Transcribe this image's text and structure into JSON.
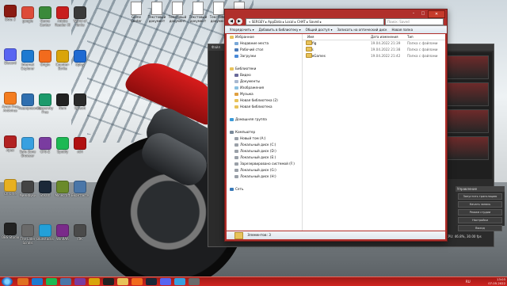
{
  "desktop_icons": [
    {
      "label": "Dota 2",
      "color": "#8a1a12"
    },
    {
      "label": "Discord",
      "color": "#5865f2"
    },
    {
      "label": "Avast Free Antivirus",
      "color": "#f47d20"
    },
    {
      "label": "Apex",
      "color": "#b22222"
    },
    {
      "label": "Chrome",
      "color": "#e8b020"
    },
    {
      "label": "OBS Studio",
      "color": "#222222"
    },
    {
      "label": "google",
      "color": "#dd4b39"
    },
    {
      "label": "Internet Explorer",
      "color": "#1e7ad1"
    },
    {
      "label": "Кеширование",
      "color": "#2f6fb0"
    },
    {
      "label": "Safe Zone Browser",
      "color": "#38a0e0"
    },
    {
      "label": "Минибуки",
      "color": "#444444"
    },
    {
      "label": "The Elder Scrolls",
      "color": "#6a6a6a"
    },
    {
      "label": "Game Center",
      "color": "#3a8a3a"
    },
    {
      "label": "Origin",
      "color": "#f26b1d"
    },
    {
      "label": "Kaspersky Free",
      "color": "#1b9a6b"
    },
    {
      "label": "CPU-Z",
      "color": "#7a3ca0"
    },
    {
      "label": "Steam",
      "color": "#1b2838"
    },
    {
      "label": "Bluestacks",
      "color": "#23a0d8"
    },
    {
      "label": "Adobe Reader XI",
      "color": "#c81e1e"
    },
    {
      "label": "Counter-Strike",
      "color": "#d9a40a"
    },
    {
      "label": "Nero",
      "color": "#222222"
    },
    {
      "label": "Spotify",
      "color": "#1db954"
    },
    {
      "label": "Minecraft",
      "color": "#6a8a2a"
    },
    {
      "label": "WinRAR",
      "color": "#7a2a8a"
    },
    {
      "label": "World of Tanks",
      "color": "#3a3a3a"
    },
    {
      "label": "Uplay",
      "color": "#1e6ad2"
    },
    {
      "label": "Ubisoft",
      "color": "#2a2a2a"
    },
    {
      "label": "x64",
      "color": "#b01010"
    },
    {
      "label": "Вконтакте",
      "color": "#4a76a8"
    },
    {
      "label": "ПК",
      "color": "#4a4a4a"
    }
  ],
  "top_files": [
    {
      "label": "Game Center"
    },
    {
      "label": "Текстовый документ"
    },
    {
      "label": "Текстовый документ"
    },
    {
      "label": "Текстовый документ"
    },
    {
      "label": "Текстовый документ"
    },
    {
      "label": "Текстовый документ"
    }
  ],
  "explorer": {
    "breadcrumb": "« SERGEY ▸ AppData ▸ Local ▸ CHAT ▸ Saved ▸",
    "search_placeholder": "Поиск: Saved",
    "toolbar": [
      "Упорядочить ▾",
      "Добавить в библиотеку ▾",
      "Общий доступ ▾",
      "Записать на оптический диск",
      "Новая папка"
    ],
    "nav": [
      {
        "label": "Избранное",
        "color": "#e8c25a",
        "indent": 0
      },
      {
        "label": "Недавние места",
        "color": "#7aa8d8",
        "indent": 1
      },
      {
        "label": "Рабочий стол",
        "color": "#4a7ab8",
        "indent": 1
      },
      {
        "label": "Загрузки",
        "color": "#4a8ad8",
        "indent": 1
      },
      {
        "label": "",
        "color": "transparent",
        "indent": 0
      },
      {
        "label": "Библиотеки",
        "color": "#e8c25a",
        "indent": 0
      },
      {
        "label": "Видео",
        "color": "#6a6a9a",
        "indent": 1
      },
      {
        "label": "Документы",
        "color": "#a8b8d0",
        "indent": 1
      },
      {
        "label": "Изображения",
        "color": "#8ac0e0",
        "indent": 1
      },
      {
        "label": "Музыка",
        "color": "#e0a040",
        "indent": 1
      },
      {
        "label": "Новая библиотека (2)",
        "color": "#e8c25a",
        "indent": 1
      },
      {
        "label": "Новая библиотека",
        "color": "#e8c25a",
        "indent": 1
      },
      {
        "label": "",
        "color": "transparent",
        "indent": 0
      },
      {
        "label": "Домашняя группа",
        "color": "#3a9ad8",
        "indent": 0
      },
      {
        "label": "",
        "color": "transparent",
        "indent": 0
      },
      {
        "label": "Компьютер",
        "color": "#7a8a9a",
        "indent": 0
      },
      {
        "label": "Новый том (A:)",
        "color": "#9aa0a8",
        "indent": 1
      },
      {
        "label": "Локальный диск (C:)",
        "color": "#9aa0a8",
        "indent": 1
      },
      {
        "label": "Локальный диск (D:)",
        "color": "#9aa0a8",
        "indent": 1
      },
      {
        "label": "Локальный диск (E:)",
        "color": "#9aa0a8",
        "indent": 1
      },
      {
        "label": "Зарезервировано системой (F:)",
        "color": "#9aa0a8",
        "indent": 1
      },
      {
        "label": "Локальный диск (G:)",
        "color": "#9aa0a8",
        "indent": 1
      },
      {
        "label": "Локальный диск (H:)",
        "color": "#9aa0a8",
        "indent": 1
      },
      {
        "label": "",
        "color": "transparent",
        "indent": 0
      },
      {
        "label": "Сеть",
        "color": "#3a7ab8",
        "indent": 0
      }
    ],
    "columns": {
      "name": "Имя",
      "date": "Дата изменения",
      "type": "Тип"
    },
    "files": [
      {
        "name": "Config",
        "date": "19.04.2022 21:39",
        "type": "Папка с файлами"
      },
      {
        "name": "Logs",
        "date": "19.04.2022 21:38",
        "type": "Папка с файлами"
      },
      {
        "name": "SaveGames",
        "date": "19.04.2022 21:42",
        "type": "Папка с файлами"
      }
    ],
    "status": "Элементов: 3"
  },
  "bg_app": {
    "menu": "Файл",
    "panel_title": "Управление",
    "buttons": [
      "Запустить трансляцию",
      "Начать запись",
      "Режим студии",
      "Настройки",
      "Выход"
    ],
    "status": "CPU: 46.8%, 30.00 fps"
  },
  "taskbar": {
    "lang": "RU",
    "time": "13:03",
    "date": "07.05.2022",
    "apps": [
      "#e07020",
      "#1e7ad1",
      "#1db954",
      "#4a76a8",
      "#7a3ca0",
      "#d9a40a",
      "#222222",
      "#e8c25a",
      "#f26b1d",
      "#1b2838",
      "#5865f2",
      "#38a0e0",
      "#6a6a6a"
    ]
  }
}
